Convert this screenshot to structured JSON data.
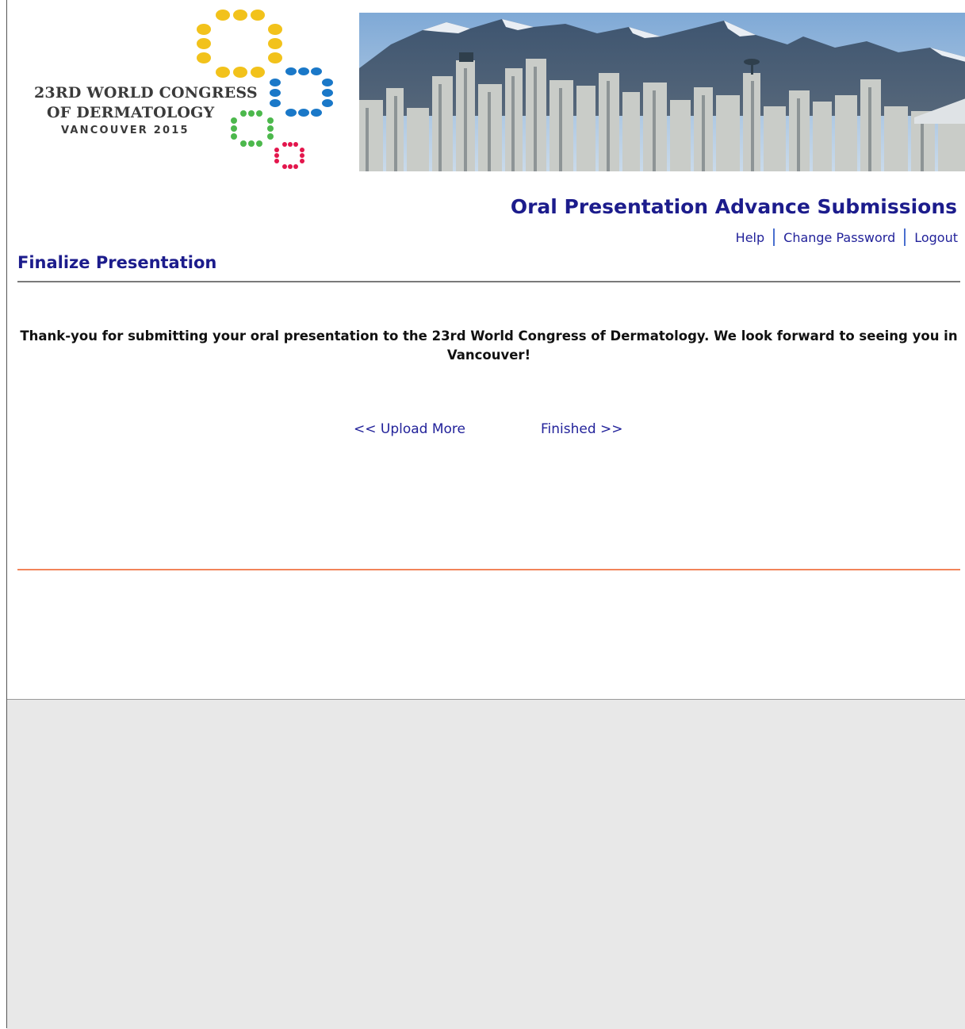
{
  "header": {
    "logo_text": {
      "line1": "23RD WORLD CONGRESS",
      "line2": "OF DERMATOLOGY",
      "line3": "VANCOUVER 2015"
    },
    "app_title": "Oral Presentation Advance Submissions",
    "nav": {
      "help": "Help",
      "change_password": "Change Password",
      "logout": "Logout"
    }
  },
  "main": {
    "page_title": "Finalize Presentation",
    "message": "Thank-you for submitting your oral presentation to the 23rd World Congress of Dermatology. We look forward to seeing you in Vancouver!",
    "actions": {
      "upload_more": "<< Upload More",
      "finished": "Finished >>"
    }
  },
  "colors": {
    "heading": "#1c1c8c",
    "link": "#22229a",
    "divider": "#7a7a7a",
    "accent_rule": "#f2845a",
    "background_gray": "#e8e8e8"
  }
}
